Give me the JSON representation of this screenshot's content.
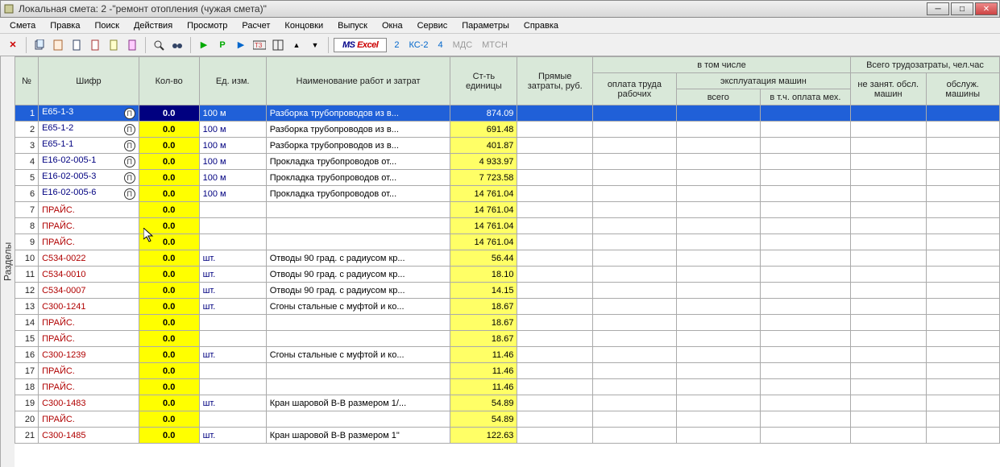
{
  "title": "Локальная смета: 2 -\"ремонт отопления (чужая смета)\"",
  "menu": [
    "Смета",
    "Правка",
    "Поиск",
    "Действия",
    "Просмотр",
    "Расчет",
    "Концовки",
    "Выпуск",
    "Окна",
    "Сервис",
    "Параметры",
    "Справка"
  ],
  "toolbar": {
    "excel": {
      "ms": "MS",
      "ex": "Excel"
    },
    "links": [
      {
        "label": "2",
        "gray": false
      },
      {
        "label": "КС-2",
        "gray": false
      },
      {
        "label": "4",
        "gray": false
      },
      {
        "label": "МДС",
        "gray": true
      },
      {
        "label": "МТСН",
        "gray": true
      }
    ]
  },
  "sidebar": "Разделы",
  "headers": {
    "num": "№",
    "shifr": "Шифр",
    "qty": "Кол-во",
    "unit": "Ед. изм.",
    "name": "Наименование работ и затрат",
    "cost": "Ст-ть единицы",
    "zatr": "Прямые затраты, руб.",
    "vtom": "в том числе",
    "opl": "оплата труда рабочих",
    "eksp": "эксплуатация машин",
    "vse": "всего",
    "vtc": "в т.ч. оплата мех.",
    "vsego": "Всего трудозатраты, чел.час",
    "nez": "не занят. обсл. машин",
    "obs": "обслуж. машины"
  },
  "rows": [
    {
      "n": "1",
      "shifr": "Е65-1-3",
      "pi": true,
      "qty": "0.0",
      "unit": "100 м",
      "name": "Разборка трубопроводов из в...",
      "cost": "874.09",
      "sel": true
    },
    {
      "n": "2",
      "shifr": "Е65-1-2",
      "pi": true,
      "qty": "0.0",
      "unit": "100 м",
      "name": "Разборка трубопроводов из в...",
      "cost": "691.48"
    },
    {
      "n": "3",
      "shifr": "Е65-1-1",
      "pi": true,
      "qty": "0.0",
      "unit": "100 м",
      "name": "Разборка трубопроводов из в...",
      "cost": "401.87"
    },
    {
      "n": "4",
      "shifr": "Е16-02-005-1",
      "pi": true,
      "qty": "0.0",
      "unit": "100 м",
      "name": "Прокладка трубопроводов от...",
      "cost": "4 933.97"
    },
    {
      "n": "5",
      "shifr": "Е16-02-005-3",
      "pi": true,
      "qty": "0.0",
      "unit": "100 м",
      "name": "Прокладка трубопроводов от...",
      "cost": "7 723.58"
    },
    {
      "n": "6",
      "shifr": "Е16-02-005-6",
      "pi": true,
      "qty": "0.0",
      "unit": "100 м",
      "name": "Прокладка трубопроводов от...",
      "cost": "14 761.04"
    },
    {
      "n": "7",
      "shifr": "ПРАЙС.",
      "red": true,
      "qty": "0.0",
      "unit": "",
      "name": "",
      "cost": "14 761.04"
    },
    {
      "n": "8",
      "shifr": "ПРАЙС.",
      "red": true,
      "qty": "0.0",
      "unit": "",
      "name": "",
      "cost": "14 761.04"
    },
    {
      "n": "9",
      "shifr": "ПРАЙС.",
      "red": true,
      "qty": "0.0",
      "unit": "",
      "name": "",
      "cost": "14 761.04"
    },
    {
      "n": "10",
      "shifr": "С534-0022",
      "red": true,
      "qty": "0.0",
      "unit": "шт.",
      "name": "Отводы 90 град. с радиусом кр...",
      "cost": "56.44"
    },
    {
      "n": "11",
      "shifr": "С534-0010",
      "red": true,
      "qty": "0.0",
      "unit": "шт.",
      "name": "Отводы 90 град. с радиусом кр...",
      "cost": "18.10"
    },
    {
      "n": "12",
      "shifr": "С534-0007",
      "red": true,
      "qty": "0.0",
      "unit": "шт.",
      "name": "Отводы 90 град. с радиусом кр...",
      "cost": "14.15"
    },
    {
      "n": "13",
      "shifr": "С300-1241",
      "red": true,
      "qty": "0.0",
      "unit": "шт.",
      "name": "Сгоны стальные с муфтой и ко...",
      "cost": "18.67"
    },
    {
      "n": "14",
      "shifr": "ПРАЙС.",
      "red": true,
      "qty": "0.0",
      "unit": "",
      "name": "",
      "cost": "18.67"
    },
    {
      "n": "15",
      "shifr": "ПРАЙС.",
      "red": true,
      "qty": "0.0",
      "unit": "",
      "name": "",
      "cost": "18.67"
    },
    {
      "n": "16",
      "shifr": "С300-1239",
      "red": true,
      "qty": "0.0",
      "unit": "шт.",
      "name": "Сгоны стальные с муфтой и ко...",
      "cost": "11.46"
    },
    {
      "n": "17",
      "shifr": "ПРАЙС.",
      "red": true,
      "qty": "0.0",
      "unit": "",
      "name": "",
      "cost": "11.46"
    },
    {
      "n": "18",
      "shifr": "ПРАЙС.",
      "red": true,
      "qty": "0.0",
      "unit": "",
      "name": "",
      "cost": "11.46"
    },
    {
      "n": "19",
      "shifr": "С300-1483",
      "red": true,
      "qty": "0.0",
      "unit": "шт.",
      "name": "Кран шаровой В-В размером 1/...",
      "cost": "54.89"
    },
    {
      "n": "20",
      "shifr": "ПРАЙС.",
      "red": true,
      "qty": "0.0",
      "unit": "",
      "name": "",
      "cost": "54.89"
    },
    {
      "n": "21",
      "shifr": "С300-1485",
      "red": true,
      "qty": "0.0",
      "unit": "шт.",
      "name": "Кран шаровой В-В размером 1\"",
      "cost": "122.63"
    }
  ]
}
